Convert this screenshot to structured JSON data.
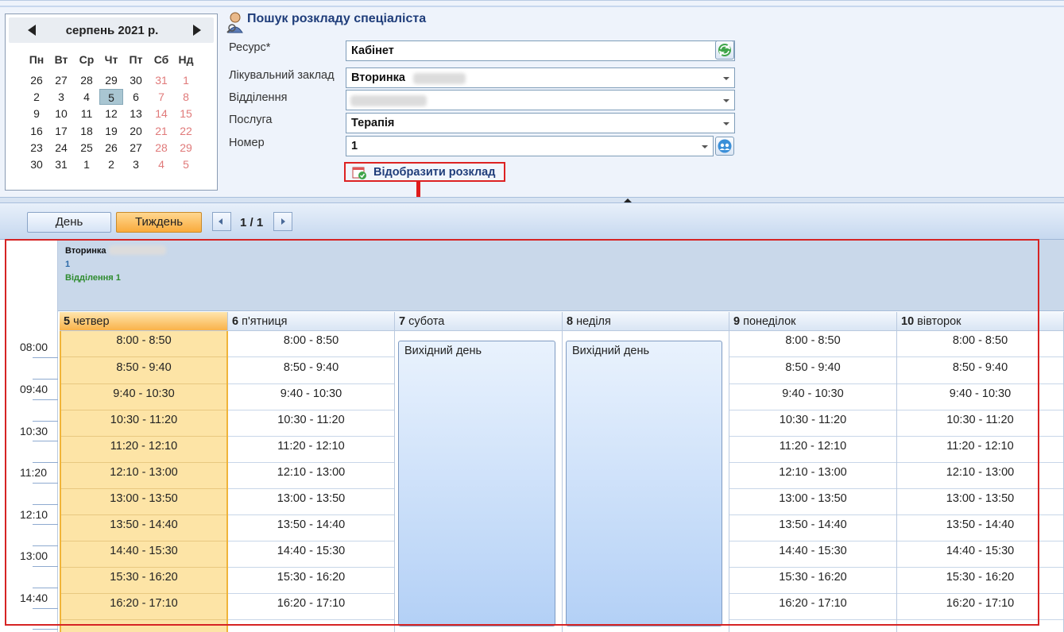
{
  "calendar": {
    "title": "серпень 2021 р.",
    "weekdays": [
      "Пн",
      "Вт",
      "Ср",
      "Чт",
      "Пт",
      "Сб",
      "Нд"
    ],
    "weeks": [
      [
        "26",
        "27",
        "28",
        "29",
        "30",
        "31",
        "1"
      ],
      [
        "2",
        "3",
        "4",
        "5",
        "6",
        "7",
        "8"
      ],
      [
        "9",
        "10",
        "11",
        "12",
        "13",
        "14",
        "15"
      ],
      [
        "16",
        "17",
        "18",
        "19",
        "20",
        "21",
        "22"
      ],
      [
        "23",
        "24",
        "25",
        "26",
        "27",
        "28",
        "29"
      ],
      [
        "30",
        "31",
        "1",
        "2",
        "3",
        "4",
        "5"
      ]
    ],
    "selected": "5"
  },
  "form": {
    "title": "Пошук розкладу спеціаліста",
    "resource_label": "Ресурс*",
    "resource_value": "Кабінет",
    "facility_label": "Лікувальний заклад",
    "facility_value": "Вторинка",
    "department_label": "Відділення",
    "department_value": "",
    "service_label": "Послуга",
    "service_value": "Терапія",
    "number_label": "Номер",
    "number_value": "1",
    "show_button": "Відобразити розклад"
  },
  "toolbar": {
    "day_label": "День",
    "week_label": "Тиждень",
    "page_label": "1 / 1"
  },
  "scheduler": {
    "resource_name": "Вторинка",
    "resource_number": "1",
    "resource_department": "Відділення 1",
    "times": [
      "08:00",
      "09:40",
      "10:30",
      "11:20",
      "12:10",
      "13:00",
      "14:40"
    ],
    "days": [
      {
        "num": "5",
        "name": "четвер",
        "today": true,
        "off": false
      },
      {
        "num": "6",
        "name": "п'ятниця",
        "today": false,
        "off": false
      },
      {
        "num": "7",
        "name": "субота",
        "today": false,
        "off": true
      },
      {
        "num": "8",
        "name": "неділя",
        "today": false,
        "off": true
      },
      {
        "num": "9",
        "name": "понеділок",
        "today": false,
        "off": false
      },
      {
        "num": "10",
        "name": "вівторок",
        "today": false,
        "off": false
      }
    ],
    "slots": [
      "8:00 - 8:50",
      "8:50 - 9:40",
      "9:40 - 10:30",
      "10:30 - 11:20",
      "11:20 - 12:10",
      "12:10 - 13:00",
      "13:00 - 13:50",
      "13:50 - 14:40",
      "14:40 - 15:30",
      "15:30 - 16:20",
      "16:20 - 17:10"
    ],
    "off_label": "Вихідний день"
  },
  "colors": {
    "accent": "#1f3d7a",
    "today": "#fde4a6",
    "highlight": "#d62424"
  }
}
